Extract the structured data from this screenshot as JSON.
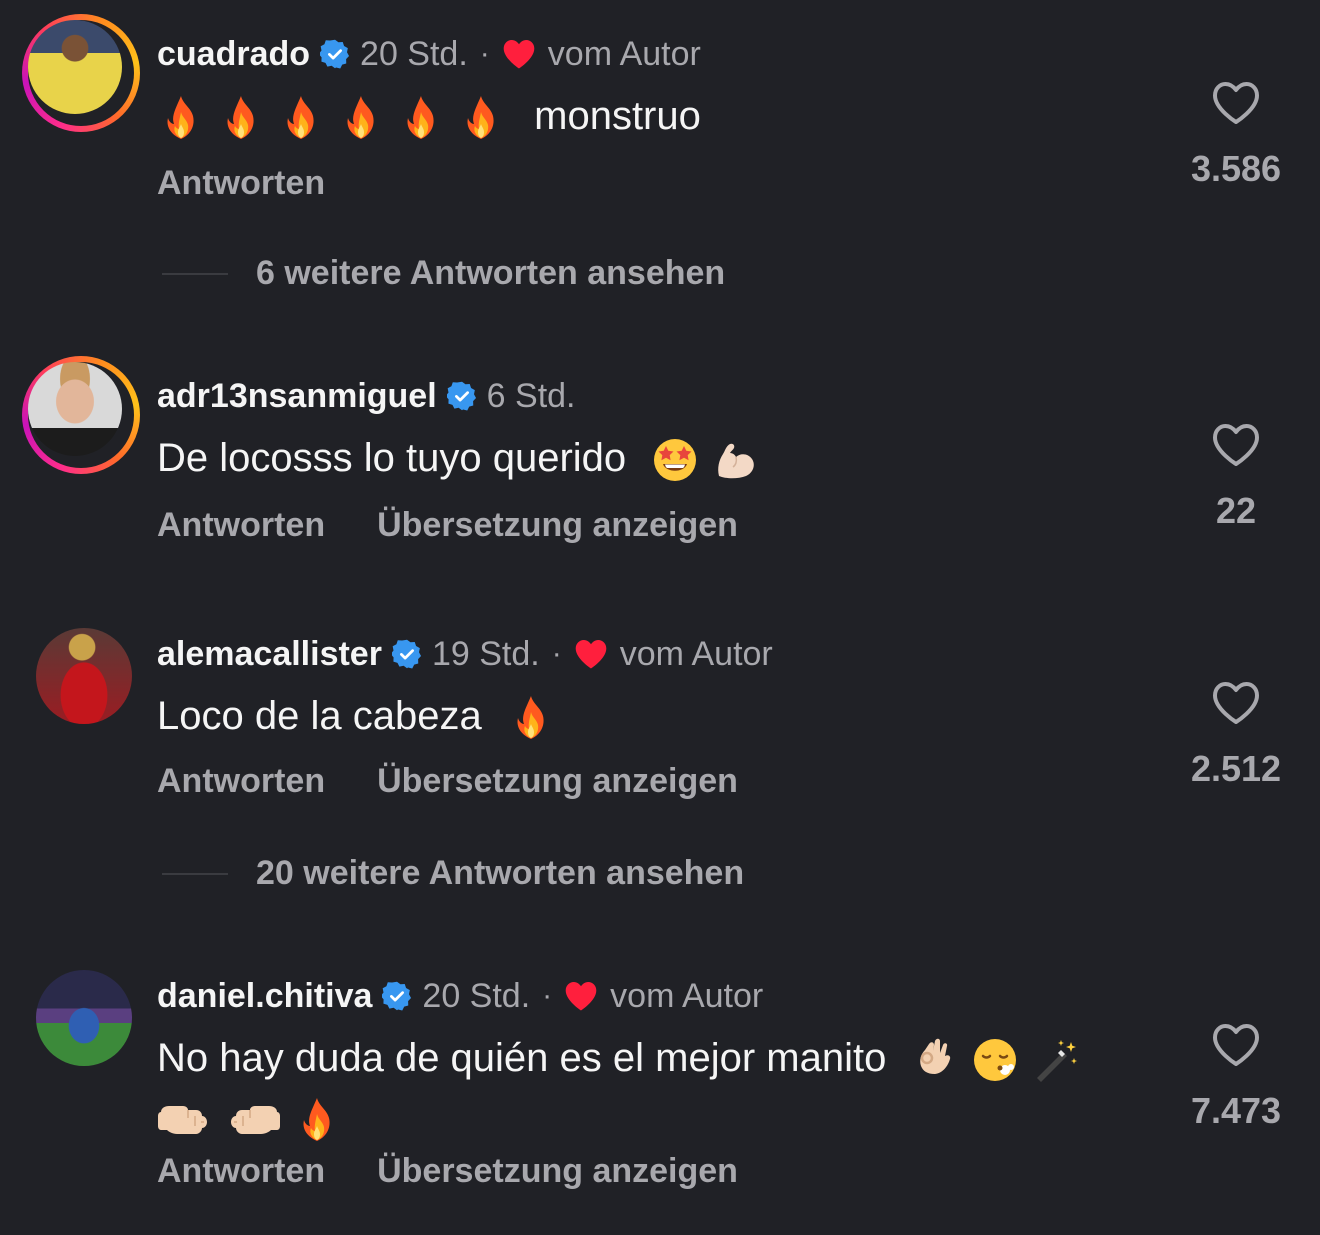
{
  "comments": [
    {
      "username": "cuadrado",
      "time": "20 Std.",
      "from_author": true,
      "author_label": "vom Autor",
      "text": "monstruo",
      "text_emojis": [
        "fire",
        "fire",
        "fire",
        "fire",
        "fire",
        "fire"
      ],
      "reply_label": "Antworten",
      "likes": "3.586",
      "more_replies": "6 weitere Antworten ansehen"
    },
    {
      "username": "adr13nsanmiguel",
      "time": "6 Std.",
      "from_author": false,
      "text": "De locosss lo tuyo querido",
      "text_emojis": [
        "star-struck",
        "flexed-biceps"
      ],
      "reply_label": "Antworten",
      "translate_label": "Übersetzung anzeigen",
      "likes": "22"
    },
    {
      "username": "alemacallister",
      "time": "19 Std.",
      "from_author": true,
      "author_label": "vom Autor",
      "text": "Loco de la cabeza",
      "text_emojis": [
        "fire"
      ],
      "reply_label": "Antworten",
      "translate_label": "Übersetzung anzeigen",
      "likes": "2.512",
      "more_replies": "20 weitere Antworten ansehen"
    },
    {
      "username": "daniel.chitiva",
      "time": "20 Std.",
      "from_author": true,
      "author_label": "vom Autor",
      "text": "No hay duda de quién es el mejor manito",
      "text_emojis": [
        "ok-hand",
        "face-exhaling",
        "magic-wand",
        "left-facing-fist",
        "right-facing-fist",
        "fire"
      ],
      "reply_label": "Antworten",
      "translate_label": "Übersetzung anzeigen",
      "likes": "7.473"
    }
  ],
  "colors": {
    "background": "#202126",
    "muted": "#a8a8ad",
    "verified": "#3897f0",
    "author_heart": "#ff1f3d"
  }
}
